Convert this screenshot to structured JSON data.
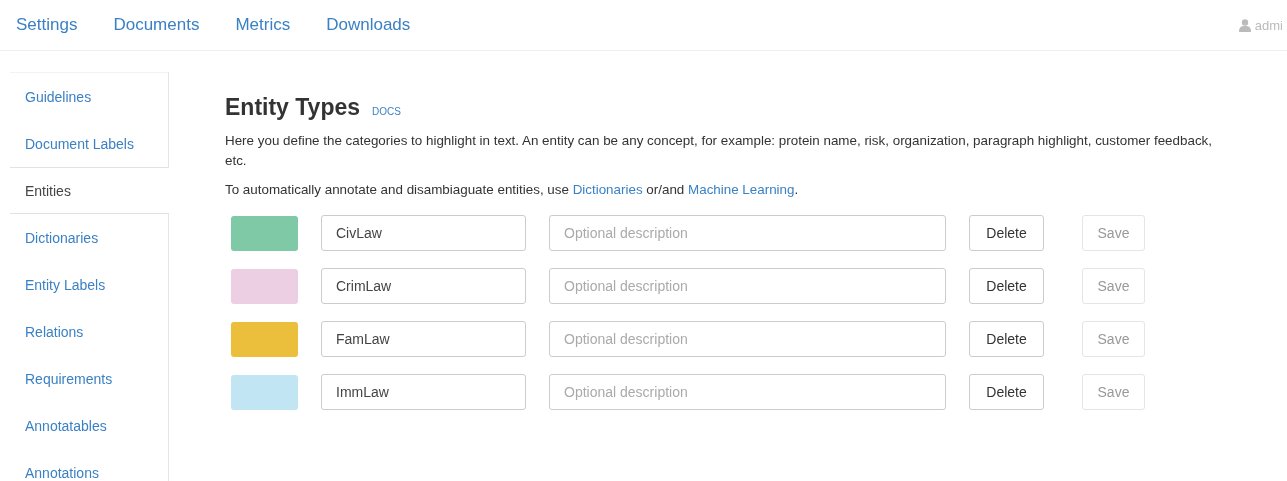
{
  "nav": {
    "items": [
      {
        "label": "Settings",
        "selected": false
      },
      {
        "label": "Documents",
        "selected": false
      },
      {
        "label": "Metrics",
        "selected": false
      },
      {
        "label": "Downloads",
        "selected": false
      }
    ],
    "user": "admi"
  },
  "sidebar": {
    "items": [
      {
        "label": "Guidelines",
        "selected": false
      },
      {
        "label": "Document Labels",
        "selected": false
      },
      {
        "label": "Entities",
        "selected": true
      },
      {
        "label": "Dictionaries",
        "selected": false
      },
      {
        "label": "Entity Labels",
        "selected": false
      },
      {
        "label": "Relations",
        "selected": false
      },
      {
        "label": "Requirements",
        "selected": false
      },
      {
        "label": "Annotatables",
        "selected": false
      },
      {
        "label": "Annotations",
        "selected": false
      }
    ]
  },
  "page": {
    "title": "Entity Types",
    "docs_link": "DOCS",
    "description": "Here you define the categories to highlight in text. An entity can be any concept, for example: protein name, risk, organization, paragraph highlight, customer feedback, etc.",
    "hint_before": "To automatically annotate and disambiaguate entities, use",
    "link_1": "Dictionaries",
    "hint_middle": "or/and",
    "link_2": "Machine Learning",
    "hint_after": "."
  },
  "entities": [
    {
      "color": "#7fc9a6",
      "name": "CivLaw",
      "placeholder": "Optional description",
      "delete": "Delete",
      "save": "Save",
      "save_disabled": true
    },
    {
      "color": "#eccfe2",
      "name": "CrimLaw",
      "placeholder": "Optional description",
      "delete": "Delete",
      "save": "Save",
      "save_disabled": true
    },
    {
      "color": "#ebbf3c",
      "name": "FamLaw",
      "placeholder": "Optional description",
      "delete": "Delete",
      "save": "Save",
      "save_disabled": true
    },
    {
      "color": "#c2e5f3",
      "name": "ImmLaw",
      "placeholder": "Optional description",
      "delete": "Delete",
      "save": "Save",
      "save_disabled": true
    }
  ]
}
